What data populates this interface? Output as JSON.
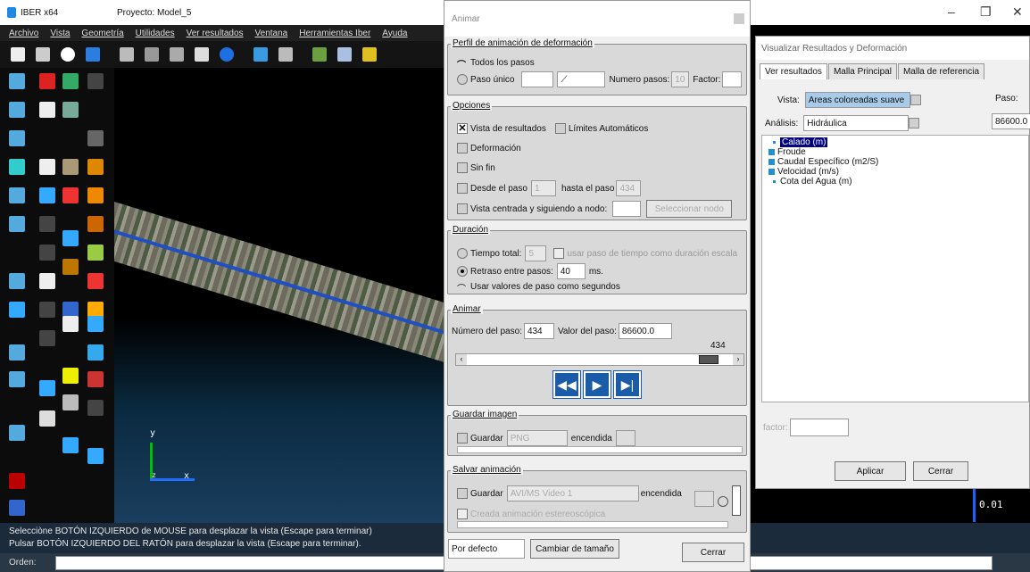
{
  "window": {
    "app": "IBER x64",
    "project": "Proyecto: Model_5",
    "controls": [
      "–",
      "❐",
      "✕"
    ]
  },
  "menu": [
    "Archivo",
    "Vista",
    "Geometría",
    "Utilidades",
    "Ver resultados",
    "Ventana",
    "Herramientas Iber",
    "Ayuda"
  ],
  "viewport": {
    "axis_y": "y",
    "axis_x": "x",
    "axis_z": "z"
  },
  "status": {
    "line1": "Selecciòne BOTÓN IZQUIERDO de MOUSE para desplazar la vista (Escape para terminar)",
    "line2": "Pulsar BOTÓN IZQUIERDO DEL RATÓN  para desplazar la vista (Escape para terminar).",
    "order_label": "Orden:"
  },
  "legend": {
    "value": "0.01"
  },
  "animar": {
    "title": "Animar",
    "perfil": {
      "title": "Perfil de animación de deformación",
      "todos": "Todos los pasos",
      "paso_unico": "Paso único",
      "numero_pasos_label": "Numero pasos:",
      "numero_pasos_value": "10",
      "factor_label": "Factor:"
    },
    "opciones": {
      "title": "Opciones",
      "vista_resultados": "Vista de resultados",
      "limites": "Límites Automáticos",
      "deformacion": "Deformación",
      "sin_fin": "Sin fin",
      "desde": "Desde el paso",
      "desde_value": "1",
      "hasta": "hasta el paso",
      "hasta_value": "434",
      "vista_centrada": "Vista centrada y siguiendo a nodo:",
      "seleccionar_nodo": "Seleccionar nodo"
    },
    "duracion": {
      "title": "Duración",
      "tiempo_total": "Tiempo total:",
      "tiempo_total_value": "5",
      "usar_paso": "usar paso de tiempo como duración escala",
      "retraso": "Retraso entre pasos:",
      "retraso_value": "40",
      "ms": "ms.",
      "usar_valores": "Usar valores de paso como segundos"
    },
    "animar": {
      "title": "Animar",
      "numero_paso_label": "Número del paso:",
      "numero_paso_value": "434",
      "valor_paso_label": "Valor del paso:",
      "valor_paso_value": "86600.0",
      "slider_value": "434",
      "slider_fraction": 0.95
    },
    "guardar_imagen": {
      "title": "Guardar imagen",
      "guardar": "Guardar",
      "format": "PNG",
      "encendida": "encendida"
    },
    "salvar_animacion": {
      "title": "Salvar animación",
      "guardar": "Guardar",
      "format": "AVI/MS Video 1",
      "encendida": "encendida",
      "estereo": "Creada animación estereoscópica"
    },
    "bottom": {
      "preset": "Por defecto",
      "cambiar": "Cambiar de tamaño",
      "cerrar": "Cerrar"
    }
  },
  "visualizar": {
    "title": "Visualizar Resultados y Deformación",
    "tabs": [
      "Ver resultados",
      "Malla Principal",
      "Malla de referencia"
    ],
    "vista_label": "Vista:",
    "vista_value": "Areas coloreadas suave",
    "paso_label": "Paso:",
    "analisis_label": "Análisis:",
    "analisis_value": "Hidráulica",
    "paso_value": "86600.0",
    "tree": [
      "Calado (m)",
      "Froude",
      "Caudal Específico (m2/S)",
      "Velocidad (m/s)",
      "Cota del Agua (m)"
    ],
    "factor_label": "factor:",
    "aplicar": "Aplicar",
    "cerrar": "Cerrar"
  }
}
